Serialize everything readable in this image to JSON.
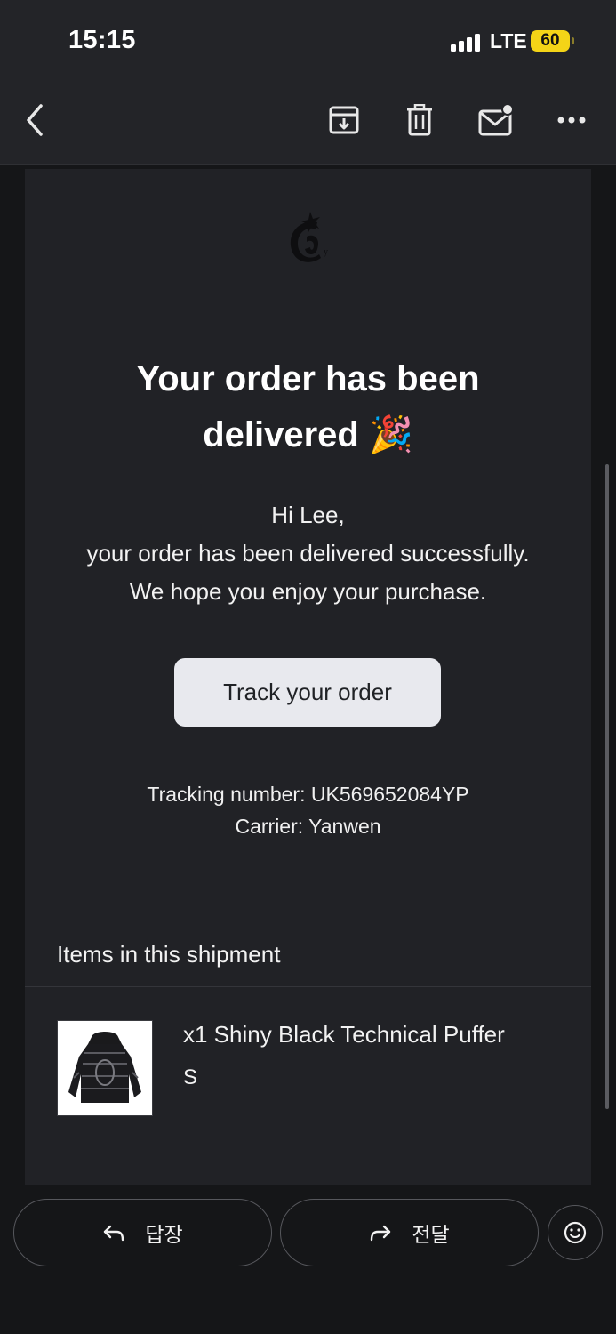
{
  "status_bar": {
    "time": "15:15",
    "network": "LTE",
    "battery": "60"
  },
  "toolbar": {
    "icons": [
      "back-icon",
      "archive-icon",
      "trash-icon",
      "mark-unread-icon",
      "more-icon"
    ]
  },
  "email": {
    "headline_line1": "Your order has been",
    "headline_line2": "delivered",
    "headline_emoji": "🎉",
    "greeting": "Hi Lee,",
    "message_line1": "your order has been delivered successfully.",
    "message_line2": "We hope you enjoy your purchase.",
    "track_button": "Track your order",
    "tracking_number": "Tracking number: UK569652084YP",
    "carrier": "Carrier: Yanwen",
    "items_title": "Items in this shipment",
    "item": {
      "name": "x1 Shiny Black Technical Puffer",
      "size": "S"
    }
  },
  "actions": {
    "reply": "답장",
    "forward": "전달"
  },
  "colors": {
    "background": "#151618",
    "card": "#212226",
    "button": "#e8e9ee",
    "battery": "#f4d417"
  }
}
